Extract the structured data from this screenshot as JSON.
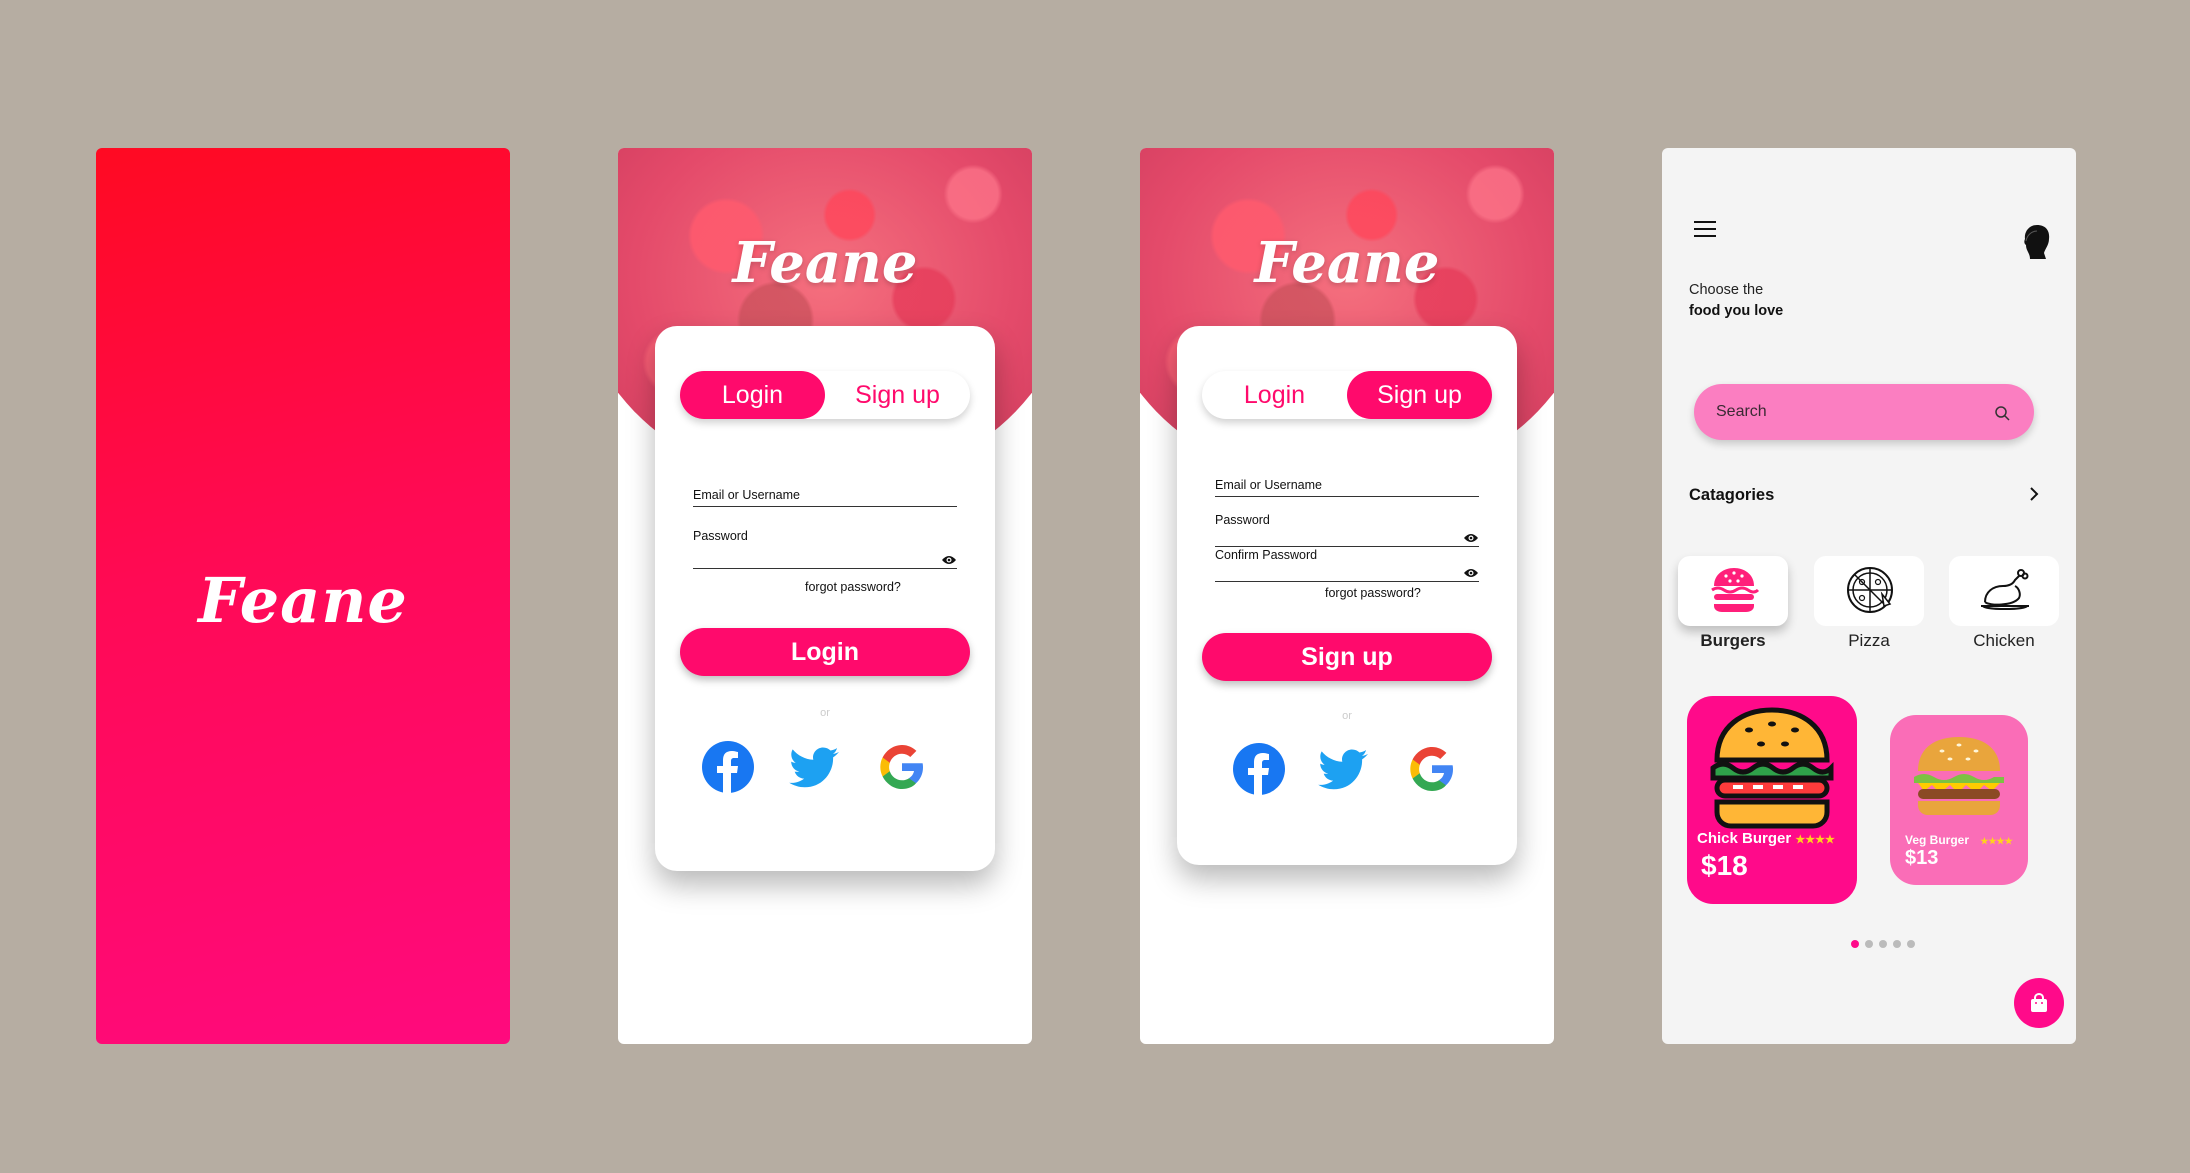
{
  "brand": "Feane",
  "colors": {
    "background": "#b6ada2",
    "primary": "#ff0a6c",
    "accent_pink": "#ff0a8a",
    "light_pink": "#fa6db7",
    "search_bg": "#fb7ec1",
    "star": "#ffd21e"
  },
  "login_screen": {
    "tabs": [
      "Login",
      "Sign up"
    ],
    "active_tab": "Login",
    "fields": {
      "email_label": "Email or Username",
      "password_label": "Password"
    },
    "forgot": "forgot password?",
    "submit": "Login",
    "or": "or",
    "social": [
      "facebook-icon",
      "twitter-icon",
      "google-icon"
    ]
  },
  "signup_screen": {
    "tabs": [
      "Login",
      "Sign up"
    ],
    "active_tab": "Sign up",
    "fields": {
      "email_label": "Email or Username",
      "password_label": "Password",
      "confirm_label": "Confirm Password"
    },
    "forgot": "forgot password?",
    "submit": "Sign up",
    "or": "or",
    "social": [
      "facebook-icon",
      "twitter-icon",
      "google-icon"
    ]
  },
  "home": {
    "tagline_1": "Choose the",
    "tagline_2": "food you love",
    "search_placeholder": "Search",
    "categories_heading": "Catagories",
    "categories": [
      {
        "label": "Burgers",
        "icon": "burger-icon",
        "selected": true
      },
      {
        "label": "Pizza",
        "icon": "pizza-icon",
        "selected": false
      },
      {
        "label": "Chicken",
        "icon": "chicken-icon",
        "selected": false
      }
    ],
    "items": [
      {
        "name": "Chick Burger",
        "rating": "★★★★",
        "price": "$18"
      },
      {
        "name": "Veg Burger",
        "rating": "★★★★",
        "price": "$13"
      }
    ],
    "pagination": {
      "count": 5,
      "active_index": 0
    }
  }
}
